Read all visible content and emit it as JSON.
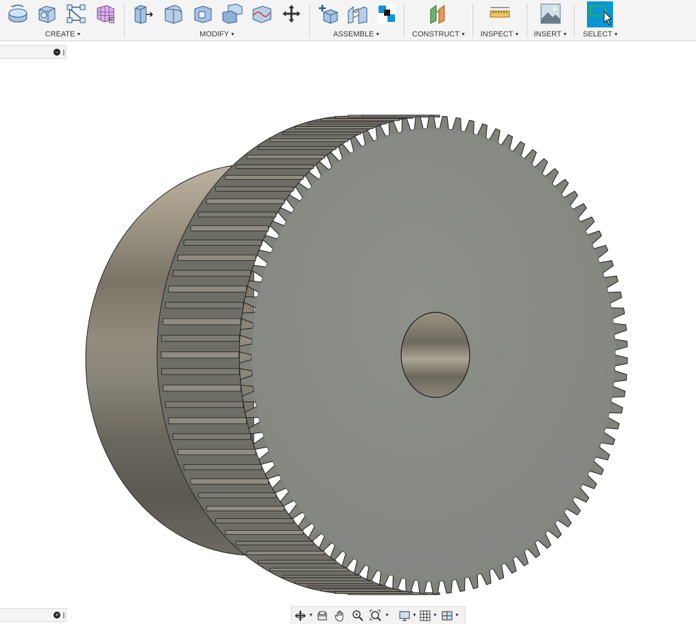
{
  "toolbar": {
    "groups": [
      {
        "id": "create",
        "label": "CREATE",
        "icons": [
          "extrude-icon",
          "box-icon",
          "sketch-icon",
          "form-icon"
        ]
      },
      {
        "id": "modify",
        "label": "MODIFY",
        "icons": [
          "press-pull-icon",
          "fillet-icon",
          "shell-icon",
          "combine-icon",
          "split-face-icon",
          "move-icon"
        ]
      },
      {
        "id": "assemble",
        "label": "ASSEMBLE",
        "icons": [
          "new-component-icon",
          "joint-icon",
          "as-built-joint-icon"
        ]
      },
      {
        "id": "construct",
        "label": "CONSTRUCT",
        "icons": [
          "offset-plane-icon"
        ]
      },
      {
        "id": "inspect",
        "label": "INSPECT",
        "icons": [
          "measure-icon"
        ]
      },
      {
        "id": "insert",
        "label": "INSERT",
        "icons": [
          "insert-image-icon"
        ]
      },
      {
        "id": "select",
        "label": "SELECT",
        "icons": [
          "select-window-icon"
        ]
      }
    ],
    "accent": "#0696d7"
  },
  "browser_panel": {
    "collapse_symbol": "−"
  },
  "comments_panel": {
    "expand_symbol": "+"
  },
  "model": {
    "description": "spur gear with cylindrical hub",
    "tooth_count": 90
  },
  "navbar": {
    "icons": [
      "orbit-icon",
      "look-at-icon",
      "pan-icon",
      "zoom-icon",
      "fit-icon",
      "display-settings-icon",
      "grid-settings-icon",
      "viewports-icon"
    ]
  },
  "colors": {
    "toolbar_bg": "#f4f4f4",
    "gear_face": "#878a82",
    "hub": "#8e877a",
    "tooth": "#7d7c74"
  }
}
